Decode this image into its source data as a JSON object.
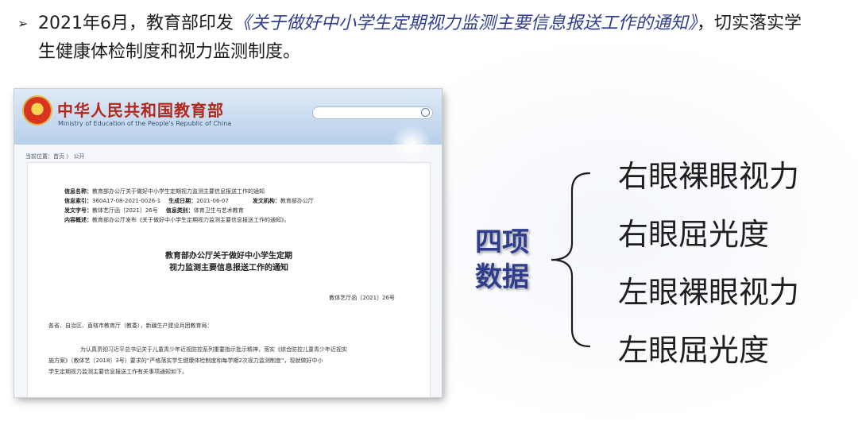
{
  "intro": {
    "bullet": "➢",
    "prefix": "2021年6月，教育部印发",
    "notice_title": "《关于做好中小学生定期视力监测主要信息报送工作的通知》",
    "suffix": "，切实落实学",
    "line2": "生健康体检制度和视力监测制度。"
  },
  "website": {
    "site_title": "中华人民共和国教育部",
    "site_subtitle": "Ministry of Education of the People's Republic of China",
    "breadcrumb": "当前位置：首页 〉 公开",
    "meta": {
      "info_name_label": "信息名称：",
      "info_name": "教育部办公厅关于做好中小学生定期视力监测主要信息报送工作的通知",
      "index_label": "信息索引：",
      "index": "360A17-08-2021-0026-1",
      "date_label": "生成日期：",
      "date": "2021-06-07",
      "issuer_label": "发文机构：",
      "issuer": "教育部办公厅",
      "doc_no_label": "发文字号：",
      "doc_no": "教体艺厅函〔2021〕26号",
      "category_label": "信息类别：",
      "category": "体育卫生与艺术教育",
      "summary_label": "内容概述：",
      "summary": "教育部办公厅发布《关于做好中小学生定期视力监测主要信息报送工作的通知》。"
    },
    "doc_title_line1": "教育部办公厅关于做好中小学生定期",
    "doc_title_line2": "视力监测主要信息报送工作的通知",
    "doc_number": "教体艺厅函〔2021〕26号",
    "salutation": "各省、自治区、直辖市教育厅（教委），新疆生产建设兵团教育局：",
    "body_line1": "为认真贯彻习近平总书记关于儿童青少年近视防控系列重要指示批示精神，落实《综合防控儿童青少年近视实",
    "body_line2": "施方案》（教体艺〔2018〕3号）要求的“严格落实学生健康体检制度和每学期2次视力监测制度”，现就做好中小",
    "body_line3": "学生定期视力监测主要信息报送工作有关事项通知如下。"
  },
  "diagram": {
    "label_line1": "四项",
    "label_line2": "数据",
    "items": [
      "右眼裸眼视力",
      "右眼屈光度",
      "左眼裸眼视力",
      "左眼屈光度"
    ],
    "accent_color": "#2f3d8f"
  }
}
